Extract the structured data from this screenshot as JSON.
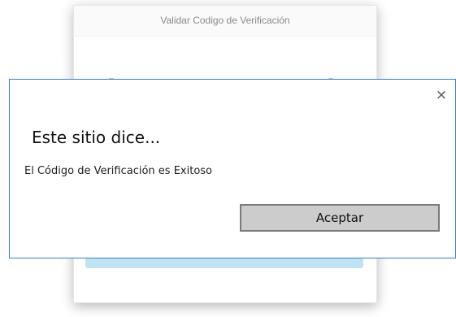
{
  "background_card": {
    "header_title": "Validar Codigo de Verificación"
  },
  "dialog": {
    "title": "Este sitio dice...",
    "message": "El Código de Verificación es Exitoso",
    "button_label": "Aceptar",
    "close_symbol": "×",
    "close_icon": "close-icon"
  },
  "colors": {
    "dialog_border": "#2b82d9",
    "button_bg": "#cccccc",
    "button_border": "#7a7a7a",
    "card_button": "#bfe3f3"
  }
}
